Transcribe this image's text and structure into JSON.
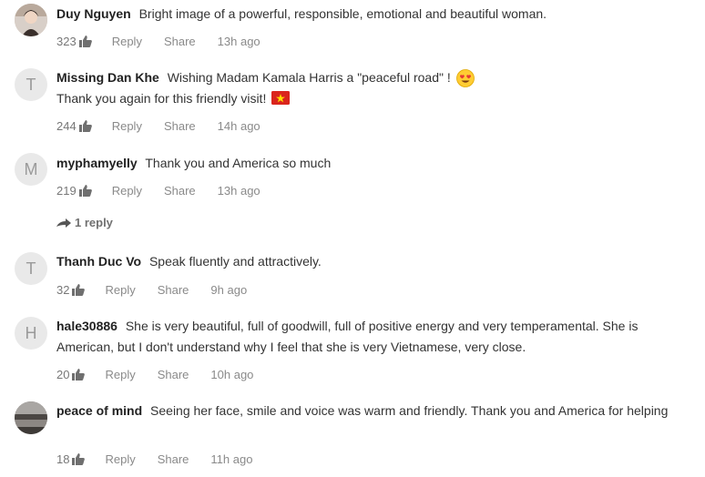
{
  "comments": [
    {
      "author": "Duy Nguyen",
      "text": "Bright image of a powerful, responsible, emotional and beautiful woman.",
      "likes": "323",
      "reply_label": "Reply",
      "share_label": "Share",
      "time": "13h ago"
    },
    {
      "author": "Missing Dan Khe",
      "avatar_letter": "T",
      "text": "Wishing Madam Kamala Harris a \"peaceful road\" !",
      "text_line2": "Thank you again for this friendly visit!",
      "likes": "244",
      "reply_label": "Reply",
      "share_label": "Share",
      "time": "14h ago"
    },
    {
      "author": "myphamyelly",
      "avatar_letter": "M",
      "text": "Thank you and America so much",
      "likes": "219",
      "reply_label": "Reply",
      "share_label": "Share",
      "time": "13h ago",
      "replies_label": "1 reply"
    },
    {
      "author": "Thanh Duc Vo",
      "avatar_letter": "T",
      "text": "Speak fluently and attractively.",
      "likes": "32",
      "reply_label": "Reply",
      "share_label": "Share",
      "time": "9h ago"
    },
    {
      "author": "hale30886",
      "avatar_letter": "H",
      "text": "She is very beautiful, full of goodwill, full of positive energy and very temperamental. She is American, but I don't understand why I feel that she is very Vietnamese, very close.",
      "likes": "20",
      "reply_label": "Reply",
      "share_label": "Share",
      "time": "10h ago"
    },
    {
      "author": "peace of mind",
      "text": "Seeing her face, smile and voice was warm and friendly. Thank you and America for helping",
      "likes": "18",
      "reply_label": "Reply",
      "share_label": "Share",
      "time": "11h ago"
    }
  ],
  "icons": {
    "like": "thumbs-up-icon",
    "reply_arrow": "reply-arrow-icon",
    "emoji": "heart-eyes-emoji",
    "flag": "vietnam-flag-icon"
  },
  "colors": {
    "author": "#222222",
    "muted": "#909090",
    "avatar_bg": "#e9e9e9",
    "flag_red": "#da251d",
    "flag_star": "#ffdd00"
  }
}
